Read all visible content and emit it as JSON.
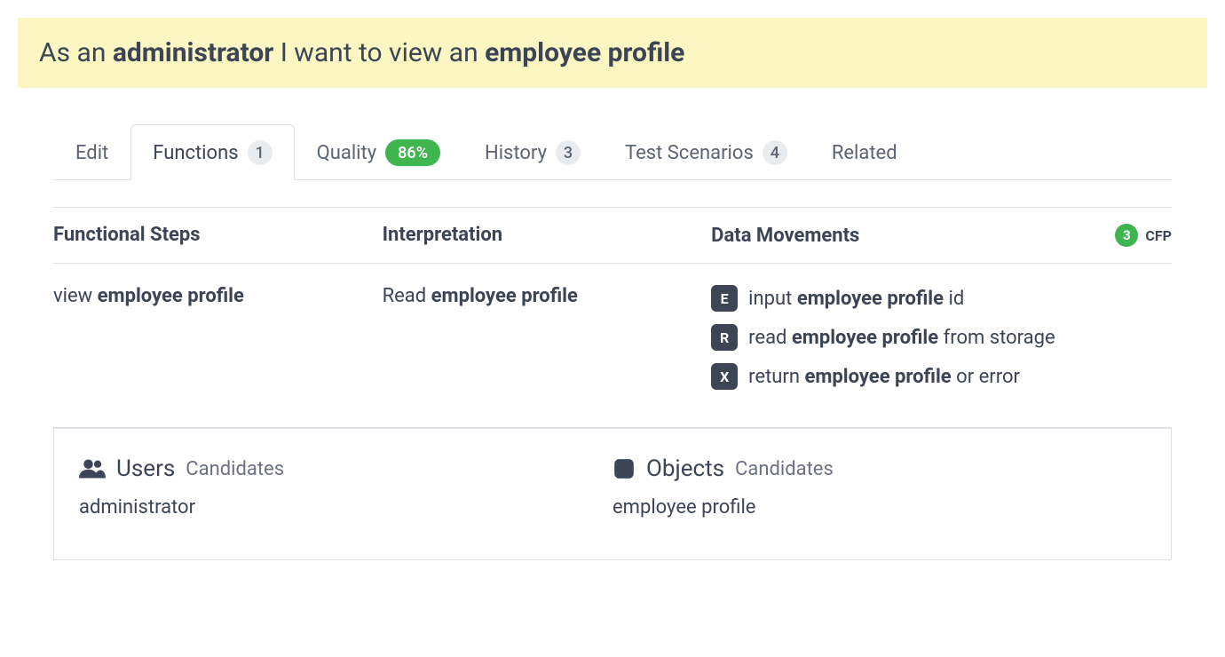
{
  "banner": {
    "pre": "As an ",
    "role": "administrator",
    "mid": " I want to view an ",
    "object": "employee profile"
  },
  "tabs": {
    "edit": "Edit",
    "functions": "Functions",
    "functions_count": "1",
    "quality": "Quality",
    "quality_pct": "86%",
    "history": "History",
    "history_count": "3",
    "test_scenarios": "Test Scenarios",
    "test_scenarios_count": "4",
    "related": "Related"
  },
  "headers": {
    "steps": "Functional Steps",
    "interp": "Interpretation",
    "movements": "Data Movements",
    "cfp_count": "3",
    "cfp_label": "CFP"
  },
  "row": {
    "step_pre": "view ",
    "step_bold": "employee profile",
    "interp_pre": "Read ",
    "interp_bold": "employee profile",
    "movements": [
      {
        "badge": "E",
        "pre": "input ",
        "bold": "employee profile",
        "post": " id"
      },
      {
        "badge": "R",
        "pre": "read ",
        "bold": "employee profile",
        "post": " from storage"
      },
      {
        "badge": "X",
        "pre": "return ",
        "bold": "employee profile",
        "post": " or error"
      }
    ]
  },
  "candidates": {
    "users_title": "Users",
    "users_sub": "Candidates",
    "users_value": "administrator",
    "objects_title": "Objects",
    "objects_sub": "Candidates",
    "objects_value": "employee profile"
  }
}
